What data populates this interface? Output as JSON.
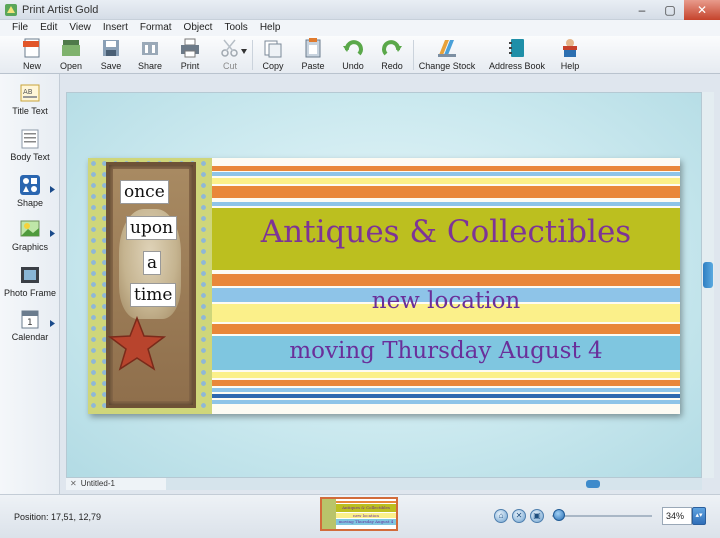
{
  "window": {
    "title": "Print Artist Gold",
    "minimize": "–",
    "maximize": "▢",
    "close": "✕"
  },
  "menu": [
    "File",
    "Edit",
    "View",
    "Insert",
    "Format",
    "Object",
    "Tools",
    "Help"
  ],
  "toolbar": {
    "new": "New",
    "open": "Open",
    "save": "Save",
    "share": "Share",
    "print": "Print",
    "cut": "Cut",
    "copy": "Copy",
    "paste": "Paste",
    "undo": "Undo",
    "redo": "Redo",
    "change_stock": "Change Stock",
    "address_book": "Address Book",
    "help": "Help"
  },
  "tools": {
    "title_text": "Title Text",
    "body_text": "Body Text",
    "shape": "Shape",
    "graphics": "Graphics",
    "photo_frame": "Photo Frame",
    "calendar": "Calendar"
  },
  "document": {
    "tab": "Untitled-1",
    "art_words": [
      "once",
      "upon",
      "a",
      "time"
    ],
    "headline": "Antiques & Collectibles",
    "line2": "new location",
    "line3": "moving Thursday August 4"
  },
  "status": {
    "position": "Position: 17,51, 12,79",
    "zoom": "34%"
  },
  "colors": {
    "stripe_orange": "#e9873a",
    "stripe_olive": "#bcbf1f",
    "stripe_blue": "#8ec4e8",
    "stripe_yellow": "#fbf08a",
    "stripe_lightblue": "#7fc6e0",
    "text_purple": "#7d3497"
  }
}
